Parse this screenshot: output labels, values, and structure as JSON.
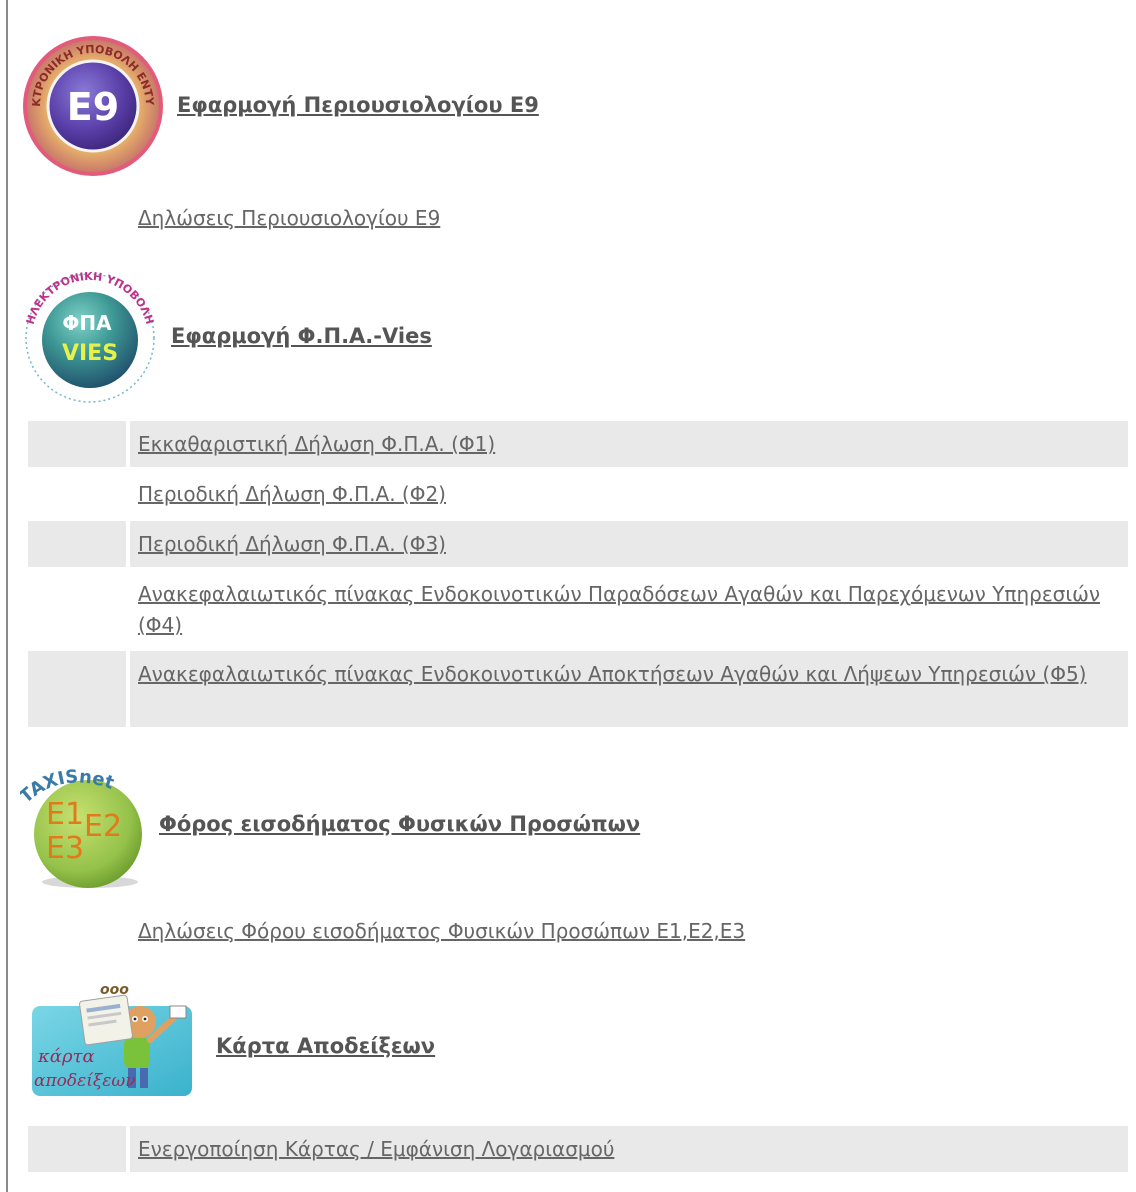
{
  "sections": [
    {
      "title": "Εφαρμογή Περιουσιολογίου Ε9",
      "icon": "e9-electronic-submission-icon",
      "icon_text": "E9",
      "icon_ring_text": "ΗΛΕΚΤΡΟΝΙΚΗ ΥΠΟΒΟΛΗ ΕΝΤΥΠΟΥ",
      "links": [
        "Δηλώσεις Περιουσιολογίου Ε9"
      ]
    },
    {
      "title": "Εφαρμογή Φ.Π.Α.-Vies",
      "icon": "vat-vies-icon",
      "icon_text_top": "ΦΠΑ",
      "icon_text_bottom": "VIES",
      "icon_ring_text": "ΗΛΕΚΤΡΟΝΙΚΗ ΥΠΟΒΟΛΗ",
      "links": [
        "Εκκαθαριστική Δήλωση Φ.Π.Α. (Φ1)",
        "Περιοδική Δήλωση Φ.Π.Α. (Φ2)",
        "Περιοδική Δήλωση Φ.Π.Α. (Φ3)",
        "Ανακεφαλαιωτικός πίνακας Ενδοκοινοτικών Παραδόσεων Αγαθών και Παρεχόμενων Υπηρεσιών (Φ4)",
        "Ανακεφαλαιωτικός πίνακας Ενδοκοινοτικών Αποκτήσεων Αγαθών και Λήψεων Υπηρεσιών (Φ5)"
      ]
    },
    {
      "title": "Φόρος εισοδήματος Φυσικών Προσώπων",
      "icon": "taxisnet-e1-e2-e3-icon",
      "icon_brand": "TAXISnet",
      "icon_labels": [
        "E1",
        "E2",
        "E3"
      ],
      "links": [
        "Δηλώσεις Φόρου εισοδήματος Φυσικών Προσώπων Ε1,Ε2,Ε3"
      ]
    },
    {
      "title": "Κάρτα Αποδείξεων",
      "icon": "receipts-card-icon",
      "icon_caption_1": "κάρτα",
      "icon_caption_2": "αποδείξεων",
      "links": [
        "Ενεργοποίηση Κάρτας / Εμφάνιση Λογαριασμού"
      ]
    }
  ],
  "colors": {
    "text": "#666666",
    "title": "#555555",
    "row_shade": "#e9e9e9"
  }
}
